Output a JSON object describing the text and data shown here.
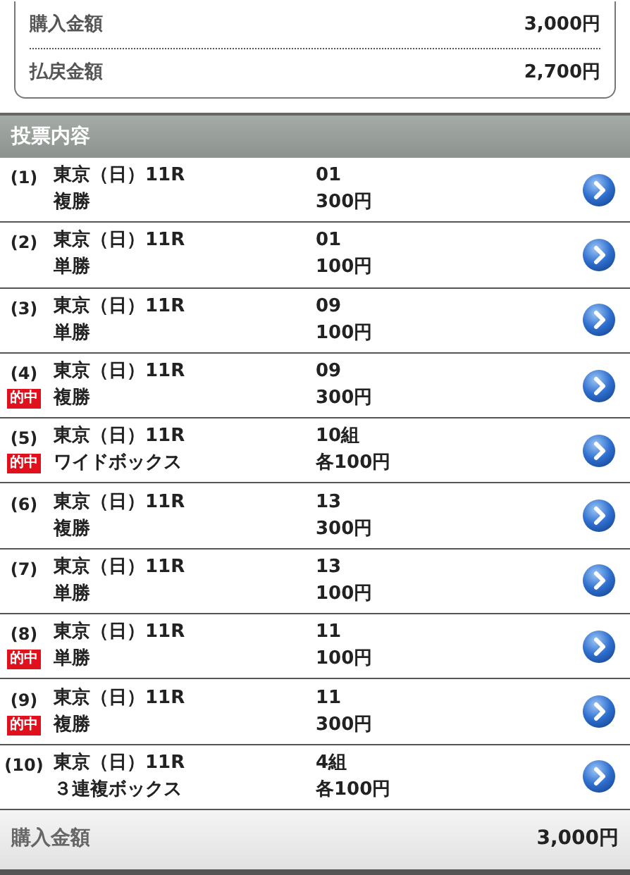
{
  "summary": [
    {
      "label": "購入金額",
      "value": "3,000円"
    },
    {
      "label": "払戻金額",
      "value": "2,700円"
    }
  ],
  "section_title": "投票内容",
  "bets": [
    {
      "no": "(1)",
      "race": "東京（日）11R",
      "type": "複勝",
      "horses": "01",
      "amount": "300円",
      "hit": false
    },
    {
      "no": "(2)",
      "race": "東京（日）11R",
      "type": "単勝",
      "horses": "01",
      "amount": "100円",
      "hit": false
    },
    {
      "no": "(3)",
      "race": "東京（日）11R",
      "type": "単勝",
      "horses": "09",
      "amount": "100円",
      "hit": false
    },
    {
      "no": "(4)",
      "race": "東京（日）11R",
      "type": "複勝",
      "horses": "09",
      "amount": "300円",
      "hit": true,
      "badge": "的中"
    },
    {
      "no": "(5)",
      "race": "東京（日）11R",
      "type": "ワイドボックス",
      "horses": "10組",
      "amount": "各100円",
      "hit": true,
      "badge": "的中"
    },
    {
      "no": "(6)",
      "race": "東京（日）11R",
      "type": "複勝",
      "horses": "13",
      "amount": "300円",
      "hit": false
    },
    {
      "no": "(7)",
      "race": "東京（日）11R",
      "type": "単勝",
      "horses": "13",
      "amount": "100円",
      "hit": false
    },
    {
      "no": "(8)",
      "race": "東京（日）11R",
      "type": "単勝",
      "horses": "11",
      "amount": "100円",
      "hit": true,
      "badge": "的中"
    },
    {
      "no": "(9)",
      "race": "東京（日）11R",
      "type": "複勝",
      "horses": "11",
      "amount": "300円",
      "hit": true,
      "badge": "的中"
    },
    {
      "no": "(10)",
      "race": "東京（日）11R",
      "type": "３連複ボックス",
      "horses": "4組",
      "amount": "各100円",
      "hit": false
    }
  ],
  "footer": {
    "label": "購入金額",
    "value": "3,000円"
  }
}
